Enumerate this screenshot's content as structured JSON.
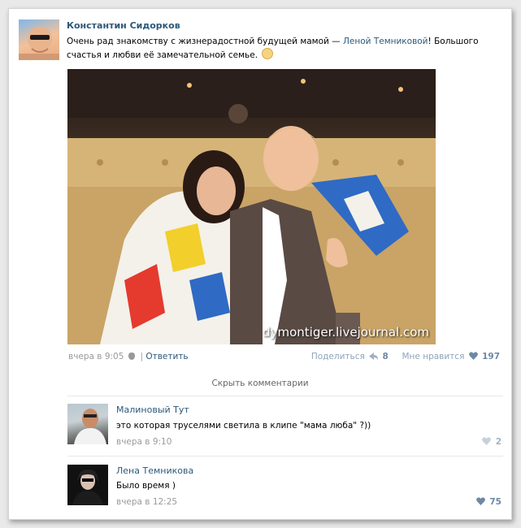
{
  "post": {
    "author": "Константин Сидорков",
    "text_before": "Очень рад знакомству с жизнерадостной будущей мамой — ",
    "mention": "Леной Темниковой",
    "text_after": "! Большого счастья и любви её замечательной семье.",
    "time": "вчера в 9:05",
    "separator": "|",
    "reply_label": "Ответить",
    "share_label": "Поделиться",
    "share_count": "8",
    "like_label": "Мне нравится",
    "like_count": "197",
    "watermark": "dymontiger.livejournal.com"
  },
  "hide_comments_label": "Скрыть комментарии",
  "comments": [
    {
      "author": "Малиновый Тут",
      "text": "это которая труселями светила в клипе \"мама люба\" ?))",
      "time": "вчера в 9:10",
      "likes": "2"
    },
    {
      "author": "Лена Темникова",
      "text": "Было время )",
      "time": "вчера в 12:25",
      "likes": "75"
    }
  ],
  "colors": {
    "link": "#2b587a",
    "muted": "#999999",
    "like": "#6d88a5"
  },
  "icons": [
    "apple-icon",
    "share-icon",
    "heart-icon",
    "smiley-emoji-icon"
  ]
}
